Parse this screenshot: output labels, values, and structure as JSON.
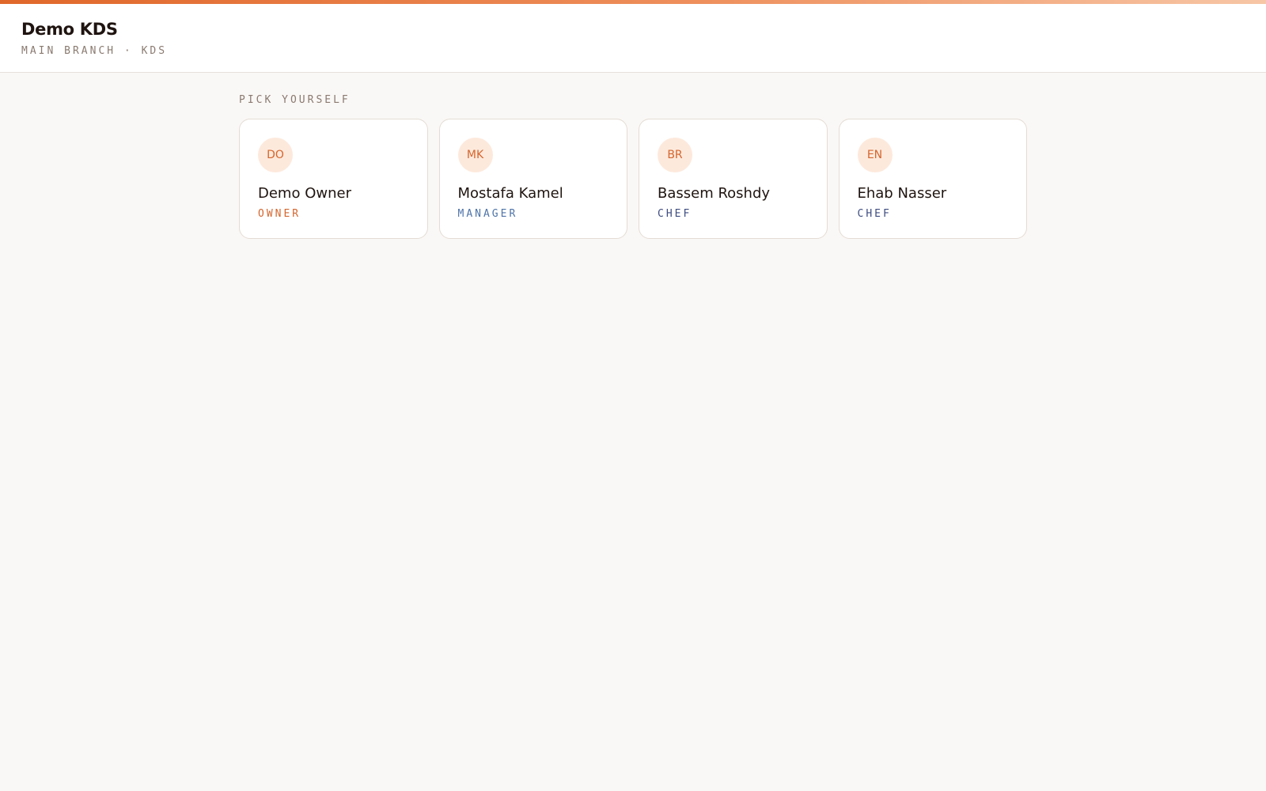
{
  "header": {
    "title": "Demo KDS",
    "subtitle": "MAIN BRANCH · KDS"
  },
  "main": {
    "section_label": "PICK YOURSELF",
    "people": [
      {
        "initials": "DO",
        "name": "Demo Owner",
        "role": "OWNER",
        "role_color": "#d4662e"
      },
      {
        "initials": "MK",
        "name": "Mostafa Kamel",
        "role": "MANAGER",
        "role_color": "#4f74a8"
      },
      {
        "initials": "BR",
        "name": "Bassem Roshdy",
        "role": "CHEF",
        "role_color": "#3e4d80"
      },
      {
        "initials": "EN",
        "name": "Ehab Nasser",
        "role": "CHEF",
        "role_color": "#3e4d80"
      }
    ]
  },
  "colors": {
    "accent": "#e0672a",
    "avatar_bg": "#fde9dc",
    "page_bg": "#faf8f6"
  }
}
